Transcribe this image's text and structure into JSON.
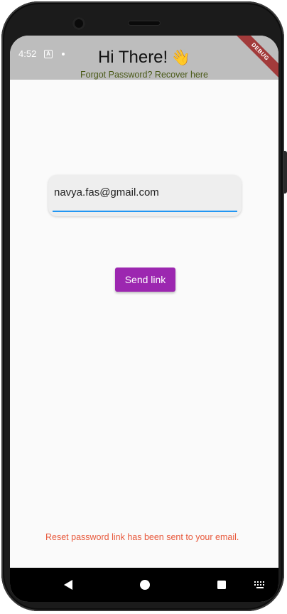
{
  "status_bar": {
    "time": "4:52",
    "notification_badge": "A"
  },
  "app_bar": {
    "title": "Hi There!",
    "title_emoji": "👋",
    "subtitle": "Forgot Password? Recover here",
    "debug_banner": "DEBUG",
    "background_color": "#bdbdbd"
  },
  "form": {
    "email_value": "navya.fas@gmail.com",
    "send_label": "Send link",
    "accent_color": "#2196f3",
    "button_color": "#9c27b0"
  },
  "feedback": {
    "message": "Reset password link has been sent to your email.",
    "color": "#e8593c"
  },
  "nav_bar": {
    "back_icon": "back-triangle-icon",
    "home_icon": "home-circle-icon",
    "recents_icon": "recents-square-icon",
    "keyboard_icon": "keyboard-icon"
  }
}
